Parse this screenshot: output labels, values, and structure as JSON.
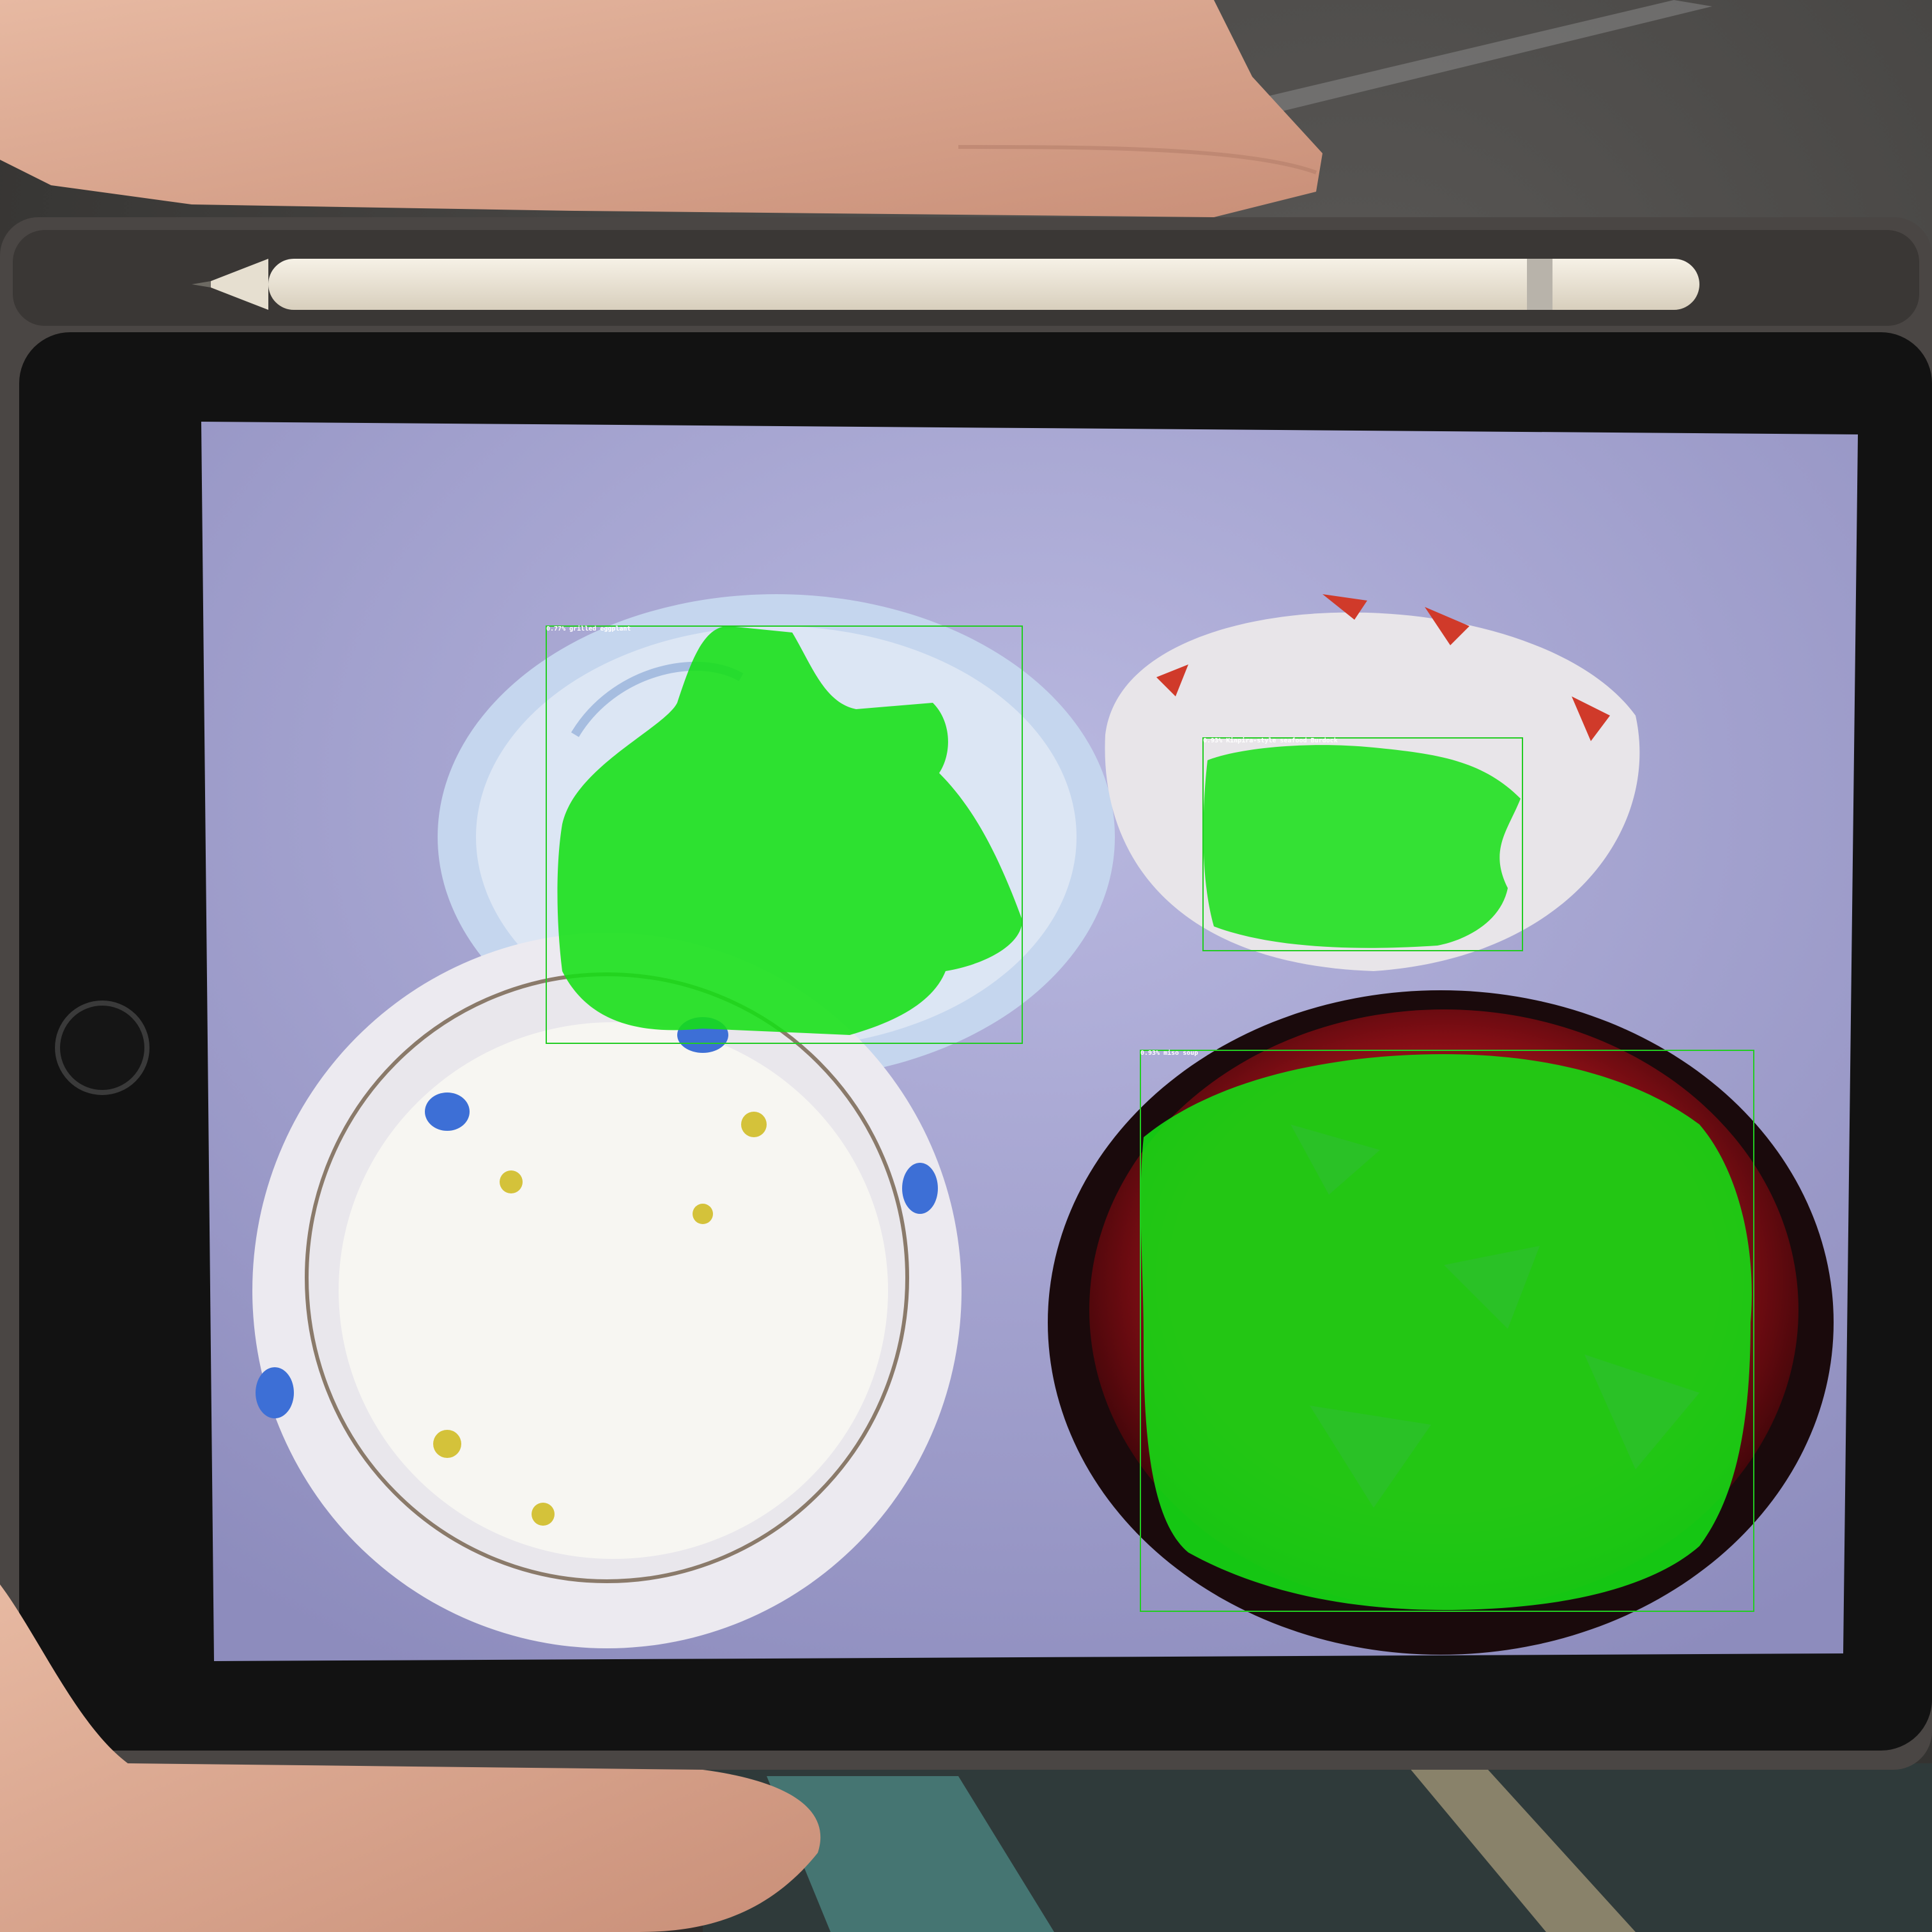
{
  "screen": {
    "detections": [
      {
        "label": "0.77% grilled eggplant",
        "color": "#00e000"
      },
      {
        "label": "0.93% Kinpira-style seafood Burdock",
        "color": "#00e000"
      },
      {
        "label": "0.93% miso soup",
        "color": "#00e000"
      }
    ]
  },
  "colors": {
    "mask": "#14e014",
    "box": "#22cc22",
    "tabletop": "#a6a6d2",
    "ipad_bezel": "#121212",
    "case": "#4a4644"
  },
  "icons": {
    "home_button": "home-button-icon",
    "pencil": "apple-pencil"
  }
}
